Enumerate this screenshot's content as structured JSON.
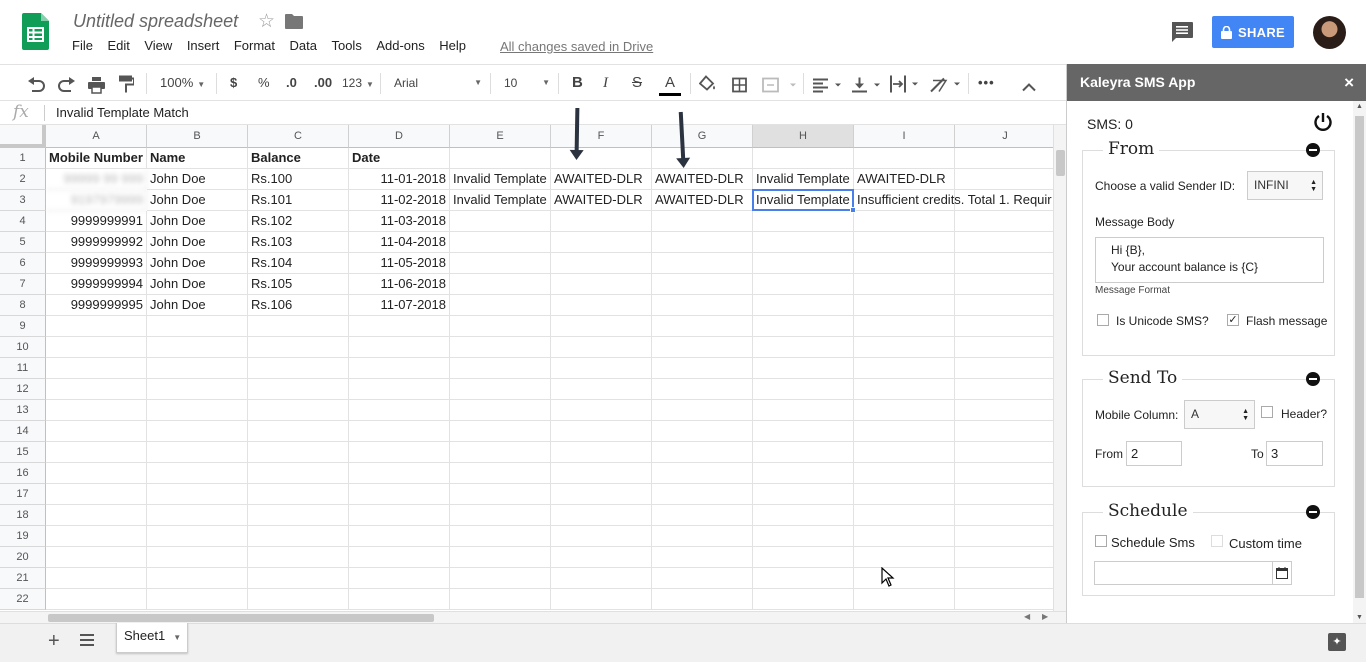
{
  "header": {
    "doc_title": "Untitled spreadsheet",
    "menu": [
      "File",
      "Edit",
      "View",
      "Insert",
      "Format",
      "Data",
      "Tools",
      "Add-ons",
      "Help"
    ],
    "saved_status": "All changes saved in Drive",
    "share_label": "SHARE",
    "brand_color": "#0f9d58",
    "share_color": "#4285f4"
  },
  "toolbar": {
    "zoom": "100%",
    "currency": "$",
    "percent": "%",
    "dec_decrease": ".0",
    "dec_increase": ".00",
    "more_formats": "123",
    "font": "Arial",
    "font_size": "10",
    "bold": "B",
    "italic": "I",
    "strike": "S",
    "text_color": "A"
  },
  "formula_bar": {
    "fx": "fx",
    "value": "Invalid Template Match"
  },
  "grid": {
    "columns": [
      "A",
      "B",
      "C",
      "D",
      "E",
      "F",
      "G",
      "H",
      "I",
      "J"
    ],
    "selected_column": "H",
    "rows": [
      "1",
      "2",
      "3",
      "4",
      "5",
      "6",
      "7",
      "8",
      "9",
      "10",
      "11",
      "12",
      "13",
      "14",
      "15",
      "16",
      "17",
      "18",
      "19",
      "20",
      "21",
      "22"
    ],
    "headers": [
      "Mobile Number",
      "Name",
      "Balance",
      "Date"
    ],
    "data": [
      [
        "99999 99 999",
        "John Doe",
        "Rs.100",
        "11-01-2018",
        "Invalid Template",
        "AWAITED-DLR",
        "AWAITED-DLR",
        "Invalid Template",
        "AWAITED-DLR"
      ],
      [
        "9197979999",
        "John Doe",
        "Rs.101",
        "11-02-2018",
        "Invalid Template",
        "AWAITED-DLR",
        "AWAITED-DLR",
        "Invalid Template",
        "Insufficient credits. Total 1. Requir"
      ],
      [
        "9999999991",
        "John Doe",
        "Rs.102",
        "11-03-2018"
      ],
      [
        "9999999992",
        "John Doe",
        "Rs.103",
        "11-04-2018"
      ],
      [
        "9999999993",
        "John Doe",
        "Rs.104",
        "11-05-2018"
      ],
      [
        "9999999994",
        "John Doe",
        "Rs.105",
        "11-06-2018"
      ],
      [
        "9999999995",
        "John Doe",
        "Rs.106",
        "11-07-2018"
      ]
    ]
  },
  "sheets": {
    "active": "Sheet1"
  },
  "sidebar": {
    "title": "Kaleyra SMS App",
    "close": "×",
    "sms_count": "SMS: 0",
    "from": {
      "legend": "From",
      "sender_label": "Choose a valid Sender ID:",
      "sender_value": "INFINI",
      "body_label": "Message Body",
      "body_line1": "Hi {B},",
      "body_line2": "Your account balance is {C}",
      "format_link": "Message Format",
      "unicode_label": "Is Unicode SMS?",
      "flash_label": "Flash message"
    },
    "send_to": {
      "legend": "Send To",
      "mobile_label": "Mobile Column:",
      "mobile_value": "A",
      "header_label": "Header?",
      "from_label": "From",
      "from_value": "2",
      "to_label": "To",
      "to_value": "3"
    },
    "schedule": {
      "legend": "Schedule",
      "schedule_label": "Schedule Sms",
      "custom_label": "Custom time"
    }
  }
}
